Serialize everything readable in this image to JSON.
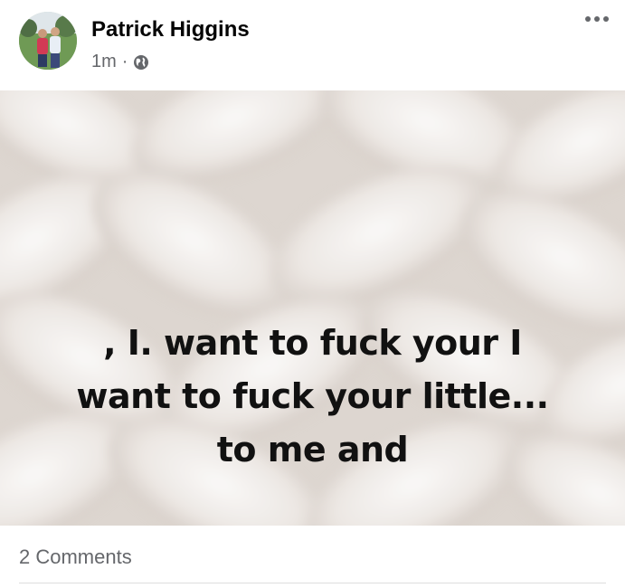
{
  "post": {
    "author": "Patrick Higgins",
    "time": "1m",
    "separator": "·",
    "privacy_icon": "globe-icon",
    "more_icon": "more-options-icon",
    "text_lines": [
      ", I. want to fuck your I",
      "want to fuck your little...",
      "to me and"
    ],
    "background": "white knit wool texture"
  },
  "footer": {
    "comments": "2 Comments"
  }
}
